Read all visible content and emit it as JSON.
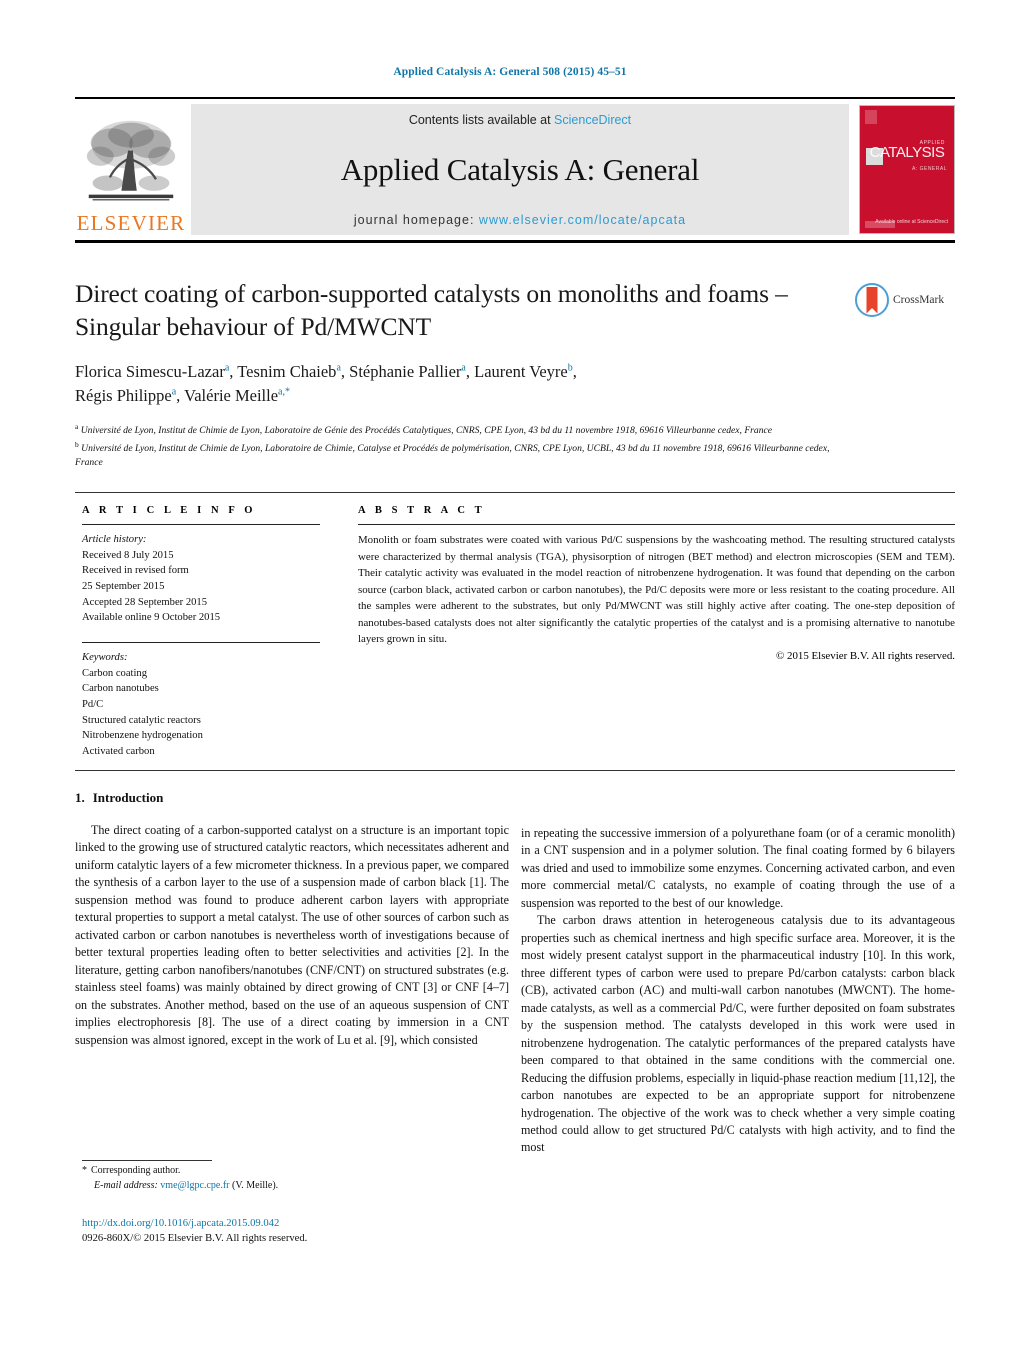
{
  "running_head": "Applied Catalysis A: General 508 (2015) 45–51",
  "masthead": {
    "publisher_name": "ELSEVIER",
    "contents_prefix": "Contents lists available at ",
    "contents_link": "ScienceDirect",
    "journal_title": "Applied Catalysis A: General",
    "homepage_prefix": "journal homepage: ",
    "homepage_url": "www.elsevier.com/locate/apcata",
    "cover": {
      "word": "CATALYSIS",
      "kicker": "APPLIED",
      "sub": "A: GENERAL",
      "bottom": "Available online at\nScienceDirect"
    }
  },
  "article": {
    "title": "Direct coating of carbon-supported catalysts on monoliths and foams – Singular behaviour of Pd/MWCNT",
    "authors_line1": "Florica Simescu-Lazar",
    "authors": [
      {
        "name": "Florica Simescu-Lazar",
        "sup": "a"
      },
      {
        "name": "Tesnim Chaieb",
        "sup": "a"
      },
      {
        "name": "Stéphanie Pallier",
        "sup": "a"
      },
      {
        "name": "Laurent Veyre",
        "sup": "b"
      },
      {
        "name": "Régis Philippe",
        "sup": "a"
      },
      {
        "name": "Valérie Meille",
        "sup": "a,*"
      }
    ],
    "affiliations": [
      {
        "marker": "a",
        "text": "Université de Lyon, Institut de Chimie de Lyon, Laboratoire de Génie des Procédés Catalytiques, CNRS, CPE Lyon, 43 bd du 11 novembre 1918, 69616 Villeurbanne cedex, France"
      },
      {
        "marker": "b",
        "text": "Université de Lyon, Institut de Chimie de Lyon, Laboratoire de Chimie, Catalyse et Procédés de polymérisation, CNRS, CPE Lyon, UCBL, 43 bd du 11 novembre 1918, 69616 Villeurbanne cedex, France"
      }
    ],
    "crossmark_label": "CrossMark"
  },
  "article_info": {
    "heading": "A R T I C L E   I N F O",
    "history_label": "Article history:",
    "history": [
      "Received 8 July 2015",
      "Received in revised form",
      "25 September 2015",
      "Accepted 28 September 2015",
      "Available online 9 October 2015"
    ],
    "keywords_label": "Keywords:",
    "keywords": [
      "Carbon coating",
      "Carbon nanotubes",
      "Pd/C",
      "Structured catalytic reactors",
      "Nitrobenzene hydrogenation",
      "Activated carbon"
    ]
  },
  "abstract": {
    "heading": "A B S T R A C T",
    "text": "Monolith or foam substrates were coated with various Pd/C suspensions by the washcoating method. The resulting structured catalysts were characterized by thermal analysis (TGA), physisorption of nitrogen (BET method) and electron microscopies (SEM and TEM). Their catalytic activity was evaluated in the model reaction of nitrobenzene hydrogenation. It was found that depending on the carbon source (carbon black, activated carbon or carbon nanotubes), the Pd/C deposits were more or less resistant to the coating procedure. All the samples were adherent to the substrates, but only Pd/MWCNT was still highly active after coating. The one-step deposition of nanotubes-based catalysts does not alter significantly the catalytic properties of the catalyst and is a promising alternative to nanotube layers grown in situ.",
    "copyright": "© 2015 Elsevier B.V. All rights reserved."
  },
  "introduction": {
    "number": "1.",
    "title": "Introduction",
    "left_paragraphs": [
      "The direct coating of a carbon-supported catalyst on a structure is an important topic linked to the growing use of structured catalytic reactors, which necessitates adherent and uniform catalytic layers of a few micrometer thickness. In a previous paper, we compared the synthesis of a carbon layer to the use of a suspension made of carbon black [1]. The suspension method was found to produce adherent carbon layers with appropriate textural properties to support a metal catalyst. The use of other sources of carbon such as activated carbon or carbon nanotubes is nevertheless worth of investigations because of better textural properties leading often to better selectivities and activities [2]. In the literature, getting carbon nanofibers/nanotubes (CNF/CNT) on structured substrates (e.g. stainless steel foams) was mainly obtained by direct growing of CNT [3] or CNF [4–7] on the substrates. Another method, based on the use of an aqueous suspension of CNT implies electrophoresis [8]. The use of a direct coating by immersion in a CNT suspension was almost ignored, except in the work of Lu et al. [9], which consisted"
    ],
    "right_paragraphs": [
      "in repeating the successive immersion of a polyurethane foam (or of a ceramic monolith) in a CNT suspension and in a polymer solution. The final coating formed by 6 bilayers was dried and used to immobilize some enzymes. Concerning activated carbon, and even more commercial metal/C catalysts, no example of coating through the use of a suspension was reported to the best of our knowledge.",
      "The carbon draws attention in heterogeneous catalysis due to its advantageous properties such as chemical inertness and high specific surface area. Moreover, it is the most widely present catalyst support in the pharmaceutical industry [10]. In this work, three different types of carbon were used to prepare Pd/carbon catalysts: carbon black (CB), activated carbon (AC) and multi-wall carbon nanotubes (MWCNT). The home-made catalysts, as well as a commercial Pd/C, were further deposited on foam substrates by the suspension method. The catalysts developed in this work were used in nitrobenzene hydrogenation. The catalytic performances of the prepared catalysts have been compared to that obtained in the same conditions with the commercial one. Reducing the diffusion problems, especially in liquid-phase reaction medium [11,12], the carbon nanotubes are expected to be an appropriate support for nitrobenzene hydrogenation. The objective of the work was to check whether a very simple coating method could allow to get structured Pd/C catalysts with high activity, and to find the most"
    ]
  },
  "footnote": {
    "star": "*",
    "corresponding": "Corresponding author.",
    "email_label": "E-mail address:",
    "email": "vme@lgpc.cpe.fr",
    "email_owner": "(V. Meille)."
  },
  "footer": {
    "doi": "http://dx.doi.org/10.1016/j.apcata.2015.09.042",
    "issn_line": "0926-860X/© 2015 Elsevier B.V. All rights reserved."
  },
  "colors": {
    "link": "#0e76a8",
    "link_light": "#2e9bd0",
    "elsevier_orange": "#E87722",
    "cover_red": "#c8102e",
    "crossmark_blue": "#4b9fd5",
    "crossmark_red": "#e8432b"
  }
}
